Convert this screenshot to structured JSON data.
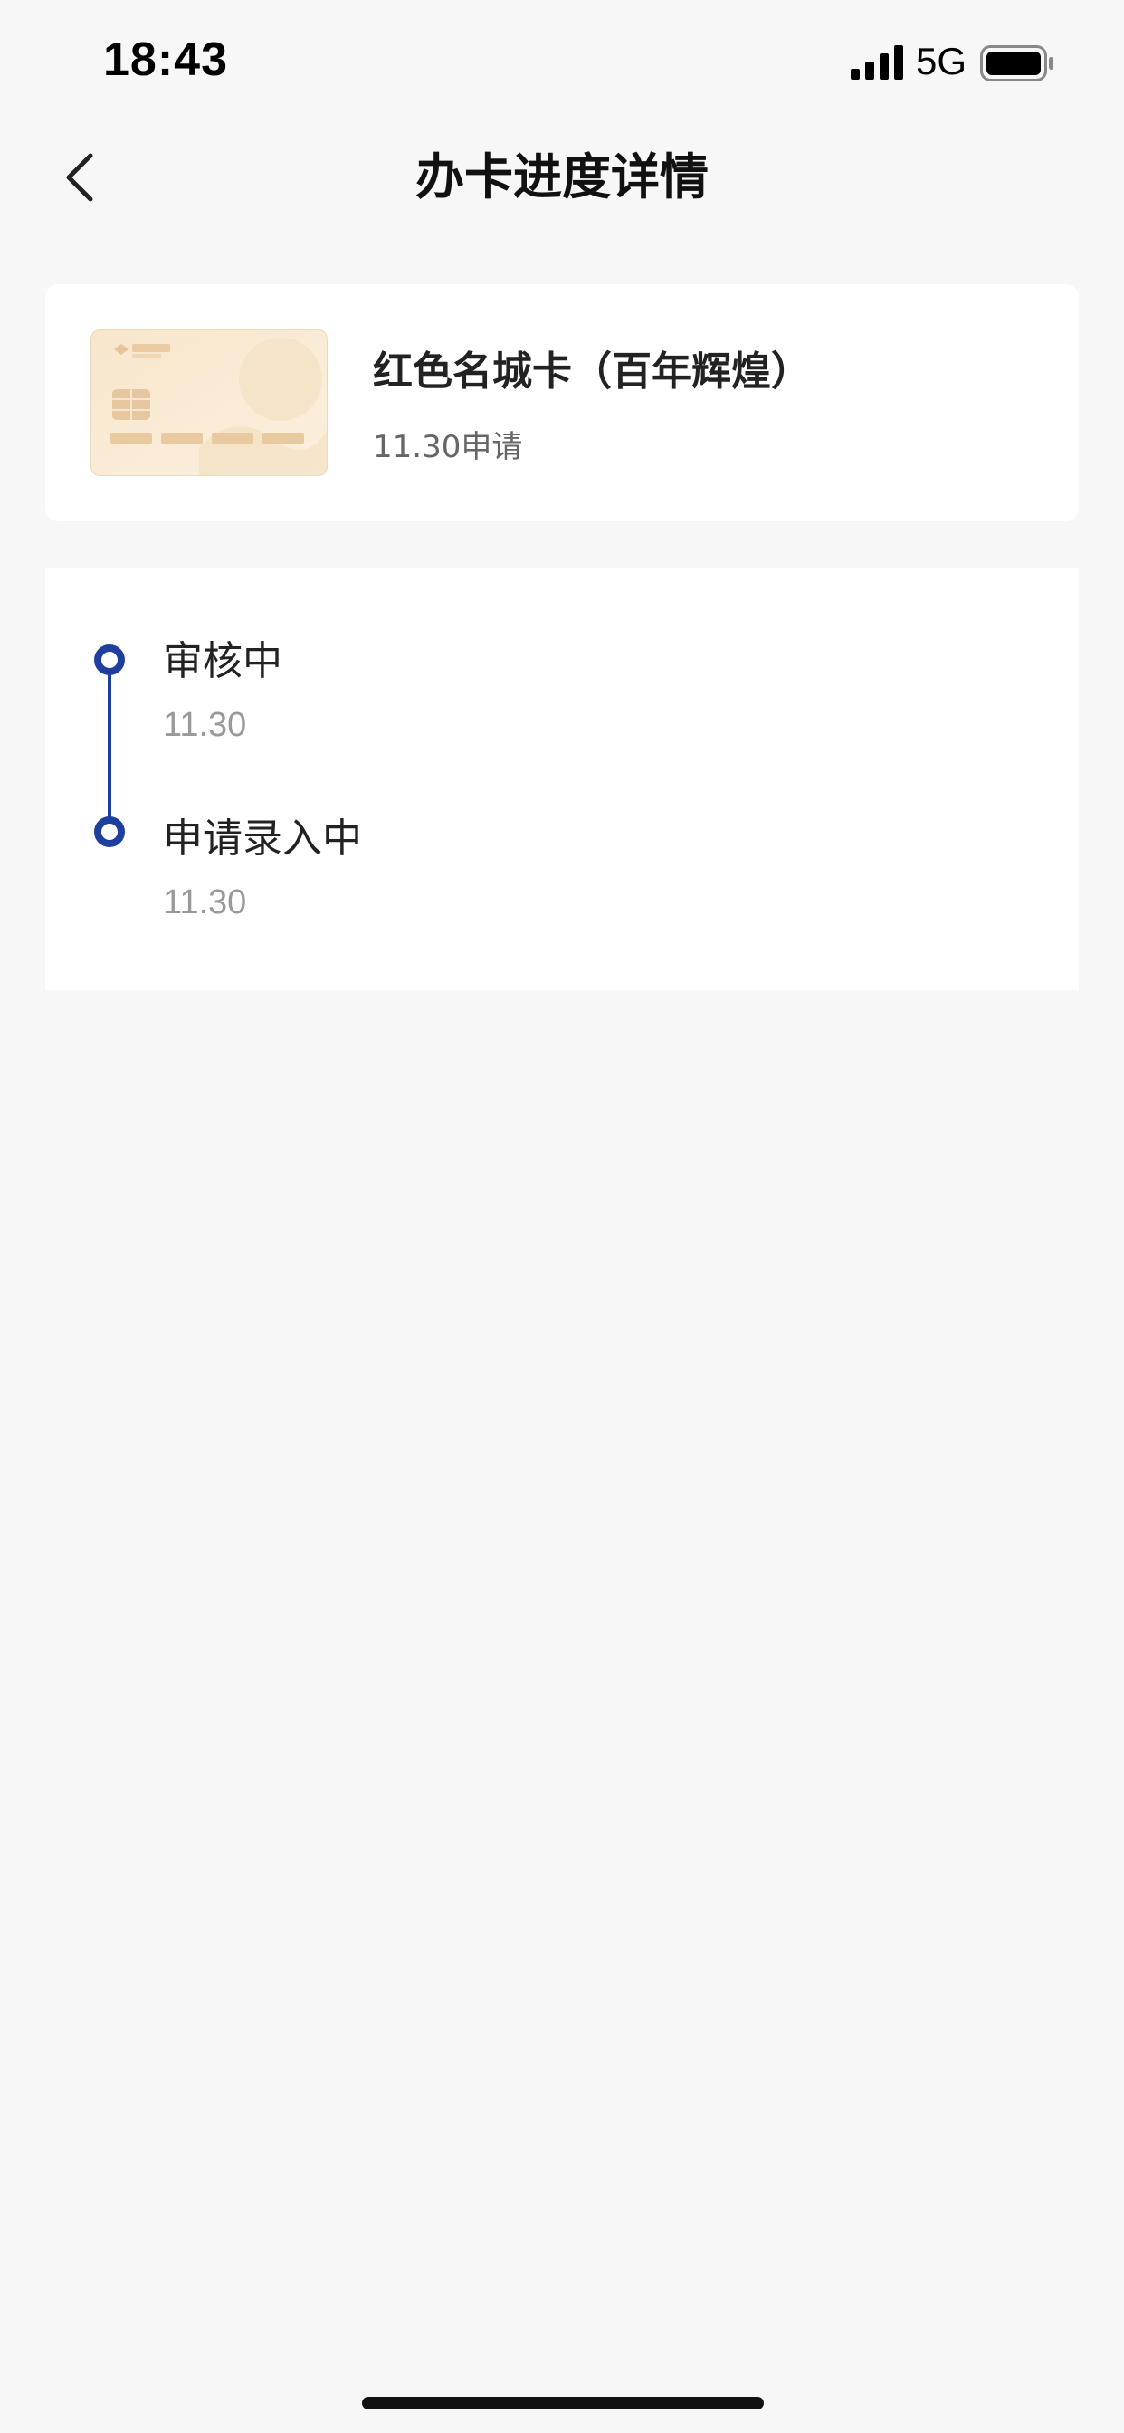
{
  "status_bar": {
    "time": "18:43",
    "network": "5G",
    "signal_icon": "signal-bars-icon",
    "battery_icon": "battery-icon",
    "battery_level": 0.9
  },
  "nav": {
    "back_icon": "chevron-left-icon",
    "title": "办卡进度详情"
  },
  "card": {
    "name": "红色名城卡（百年辉煌）",
    "apply_date": "11.30申请",
    "image_icon": "credit-card-image"
  },
  "timeline": {
    "accent_color": "#1e3f9e",
    "steps": [
      {
        "title": "审核中",
        "date": "11.30"
      },
      {
        "title": "申请录入中",
        "date": "11.30"
      }
    ]
  }
}
